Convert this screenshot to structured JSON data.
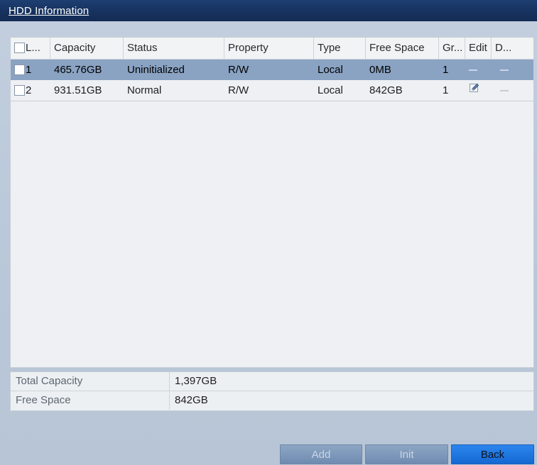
{
  "window": {
    "title": "HDD Information"
  },
  "table": {
    "columns": [
      "L...",
      "Capacity",
      "Status",
      "Property",
      "Type",
      "Free Space",
      "Gr...",
      "Edit",
      "D..."
    ],
    "rows": [
      {
        "label": "1",
        "capacity": "465.76GB",
        "status": "Uninitialized",
        "property": "R/W",
        "type": "Local",
        "free_space": "0MB",
        "group": "1",
        "edit": "unavailable",
        "delete": "unavailable",
        "selected": true
      },
      {
        "label": "2",
        "capacity": "931.51GB",
        "status": "Normal",
        "property": "R/W",
        "type": "Local",
        "free_space": "842GB",
        "group": "1",
        "edit": "edit-icon",
        "delete": "unavailable",
        "selected": false
      }
    ]
  },
  "summary": {
    "total_capacity_label": "Total Capacity",
    "total_capacity_value": "1,397GB",
    "free_space_label": "Free Space",
    "free_space_value": "842GB"
  },
  "buttons": {
    "add": "Add",
    "init": "Init",
    "back": "Back"
  },
  "colors": {
    "title_bar": "#17335f",
    "selected_row": "#8aa3c3",
    "primary_button": "#1f78e2",
    "disabled_button": "#7a95b8"
  }
}
